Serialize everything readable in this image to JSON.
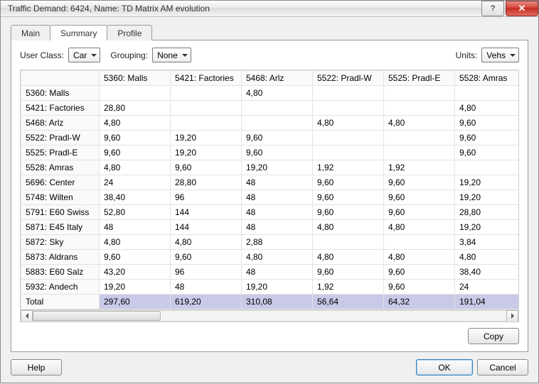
{
  "title": "Traffic Demand: 6424, Name: TD Matrix AM evolution",
  "tabs": {
    "main": "Main",
    "summary": "Summary",
    "profile": "Profile"
  },
  "controls": {
    "userClassLabel": "User Class:",
    "userClassValue": "Car",
    "groupingLabel": "Grouping:",
    "groupingValue": "None",
    "unitsLabel": "Units:",
    "unitsValue": "Vehs"
  },
  "columns": [
    "5360: Malls",
    "5421: Factories",
    "5468: Arlz",
    "5522: Pradl-W",
    "5525: Pradl-E",
    "5528: Amras"
  ],
  "rows": [
    {
      "h": "5360: Malls",
      "c": [
        "",
        "",
        "4,80",
        "",
        "",
        ""
      ]
    },
    {
      "h": "5421: Factories",
      "c": [
        "28,80",
        "",
        "",
        "",
        "",
        "4,80"
      ]
    },
    {
      "h": "5468: Arlz",
      "c": [
        "4,80",
        "",
        "",
        "4,80",
        "4,80",
        "9,60"
      ]
    },
    {
      "h": "5522: Pradl-W",
      "c": [
        "9,60",
        "19,20",
        "9,60",
        "",
        "",
        "9,60"
      ]
    },
    {
      "h": "5525: Pradl-E",
      "c": [
        "9,60",
        "19,20",
        "9,60",
        "",
        "",
        "9,60"
      ]
    },
    {
      "h": "5528: Amras",
      "c": [
        "4,80",
        "9,60",
        "19,20",
        "1,92",
        "1,92",
        ""
      ]
    },
    {
      "h": "5696: Center",
      "c": [
        "24",
        "28,80",
        "48",
        "9,60",
        "9,60",
        "19,20"
      ]
    },
    {
      "h": "5748: Wilten",
      "c": [
        "38,40",
        "96",
        "48",
        "9,60",
        "9,60",
        "19,20"
      ]
    },
    {
      "h": "5791: E60 Swiss",
      "c": [
        "52,80",
        "144",
        "48",
        "9,60",
        "9,60",
        "28,80"
      ]
    },
    {
      "h": "5871: E45 Italy",
      "c": [
        "48",
        "144",
        "48",
        "4,80",
        "4,80",
        "19,20"
      ]
    },
    {
      "h": "5872: Sky",
      "c": [
        "4,80",
        "4,80",
        "2,88",
        "",
        "",
        "3,84"
      ]
    },
    {
      "h": "5873: Aldrans",
      "c": [
        "9,60",
        "9,60",
        "4,80",
        "4,80",
        "4,80",
        "4,80"
      ]
    },
    {
      "h": "5883: E60 Salz",
      "c": [
        "43,20",
        "96",
        "48",
        "9,60",
        "9,60",
        "38,40"
      ]
    },
    {
      "h": "5932: Andech",
      "c": [
        "19,20",
        "48",
        "19,20",
        "1,92",
        "9,60",
        "24"
      ]
    }
  ],
  "totalLabel": "Total",
  "totals": [
    "297,60",
    "619,20",
    "310,08",
    "56,64",
    "64,32",
    "191,04"
  ],
  "buttons": {
    "copy": "Copy",
    "help": "Help",
    "ok": "OK",
    "cancel": "Cancel"
  }
}
